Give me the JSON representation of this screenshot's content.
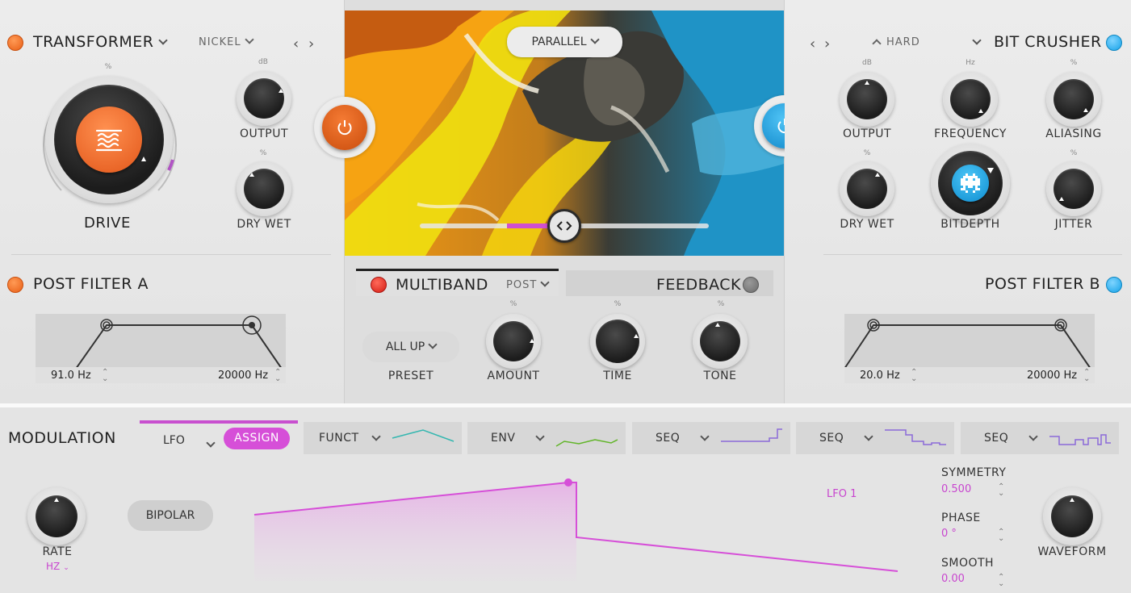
{
  "left": {
    "transformer": {
      "title": "TRANSFORMER",
      "preset": "NICKEL",
      "drive_label": "DRIVE",
      "drive_unit": "%",
      "output_label": "OUTPUT",
      "output_unit": "dB",
      "drywet_label": "DRY WET",
      "drywet_unit": "%"
    },
    "post_filter": {
      "title": "POST FILTER A",
      "low_freq": "91.0 Hz",
      "high_freq": "20000 Hz"
    }
  },
  "center": {
    "routing": "PARALLEL",
    "multiband": {
      "title": "MULTIBAND",
      "position": "POST"
    },
    "feedback": {
      "title": "FEEDBACK",
      "preset_value": "ALL UP",
      "preset_label": "PRESET",
      "amount_label": "AMOUNT",
      "time_label": "TIME",
      "tone_label": "TONE",
      "unit": "%"
    }
  },
  "right": {
    "bitcrusher": {
      "title": "BIT CRUSHER",
      "mode": "HARD",
      "output_label": "OUTPUT",
      "output_unit": "dB",
      "frequency_label": "FREQUENCY",
      "frequency_unit": "Hz",
      "aliasing_label": "ALIASING",
      "aliasing_unit": "%",
      "drywet_label": "DRY WET",
      "drywet_unit": "%",
      "bitdepth_label": "BITDEPTH",
      "jitter_label": "JITTER",
      "jitter_unit": "%"
    },
    "post_filter": {
      "title": "POST FILTER B",
      "low_freq": "20.0 Hz",
      "high_freq": "20000 Hz"
    }
  },
  "modulation": {
    "title": "MODULATION",
    "tabs": [
      {
        "label": "LFO",
        "assign": "ASSIGN"
      },
      {
        "label": "FUNCT"
      },
      {
        "label": "ENV"
      },
      {
        "label": "SEQ"
      },
      {
        "label": "SEQ"
      },
      {
        "label": "SEQ"
      }
    ],
    "rate_label": "RATE",
    "rate_unit": "HZ",
    "bipolar": "BIPOLAR",
    "lfo_name": "LFO 1",
    "symmetry_label": "SYMMETRY",
    "symmetry_value": "0.500",
    "phase_label": "PHASE",
    "phase_value": "0 °",
    "smooth_label": "SMOOTH",
    "smooth_value": "0.00",
    "waveform_label": "WAVEFORM"
  },
  "colors": {
    "orange": "#e8631a",
    "blue": "#1aa5ea",
    "magenta": "#d94fd8",
    "red": "#d8231a"
  }
}
